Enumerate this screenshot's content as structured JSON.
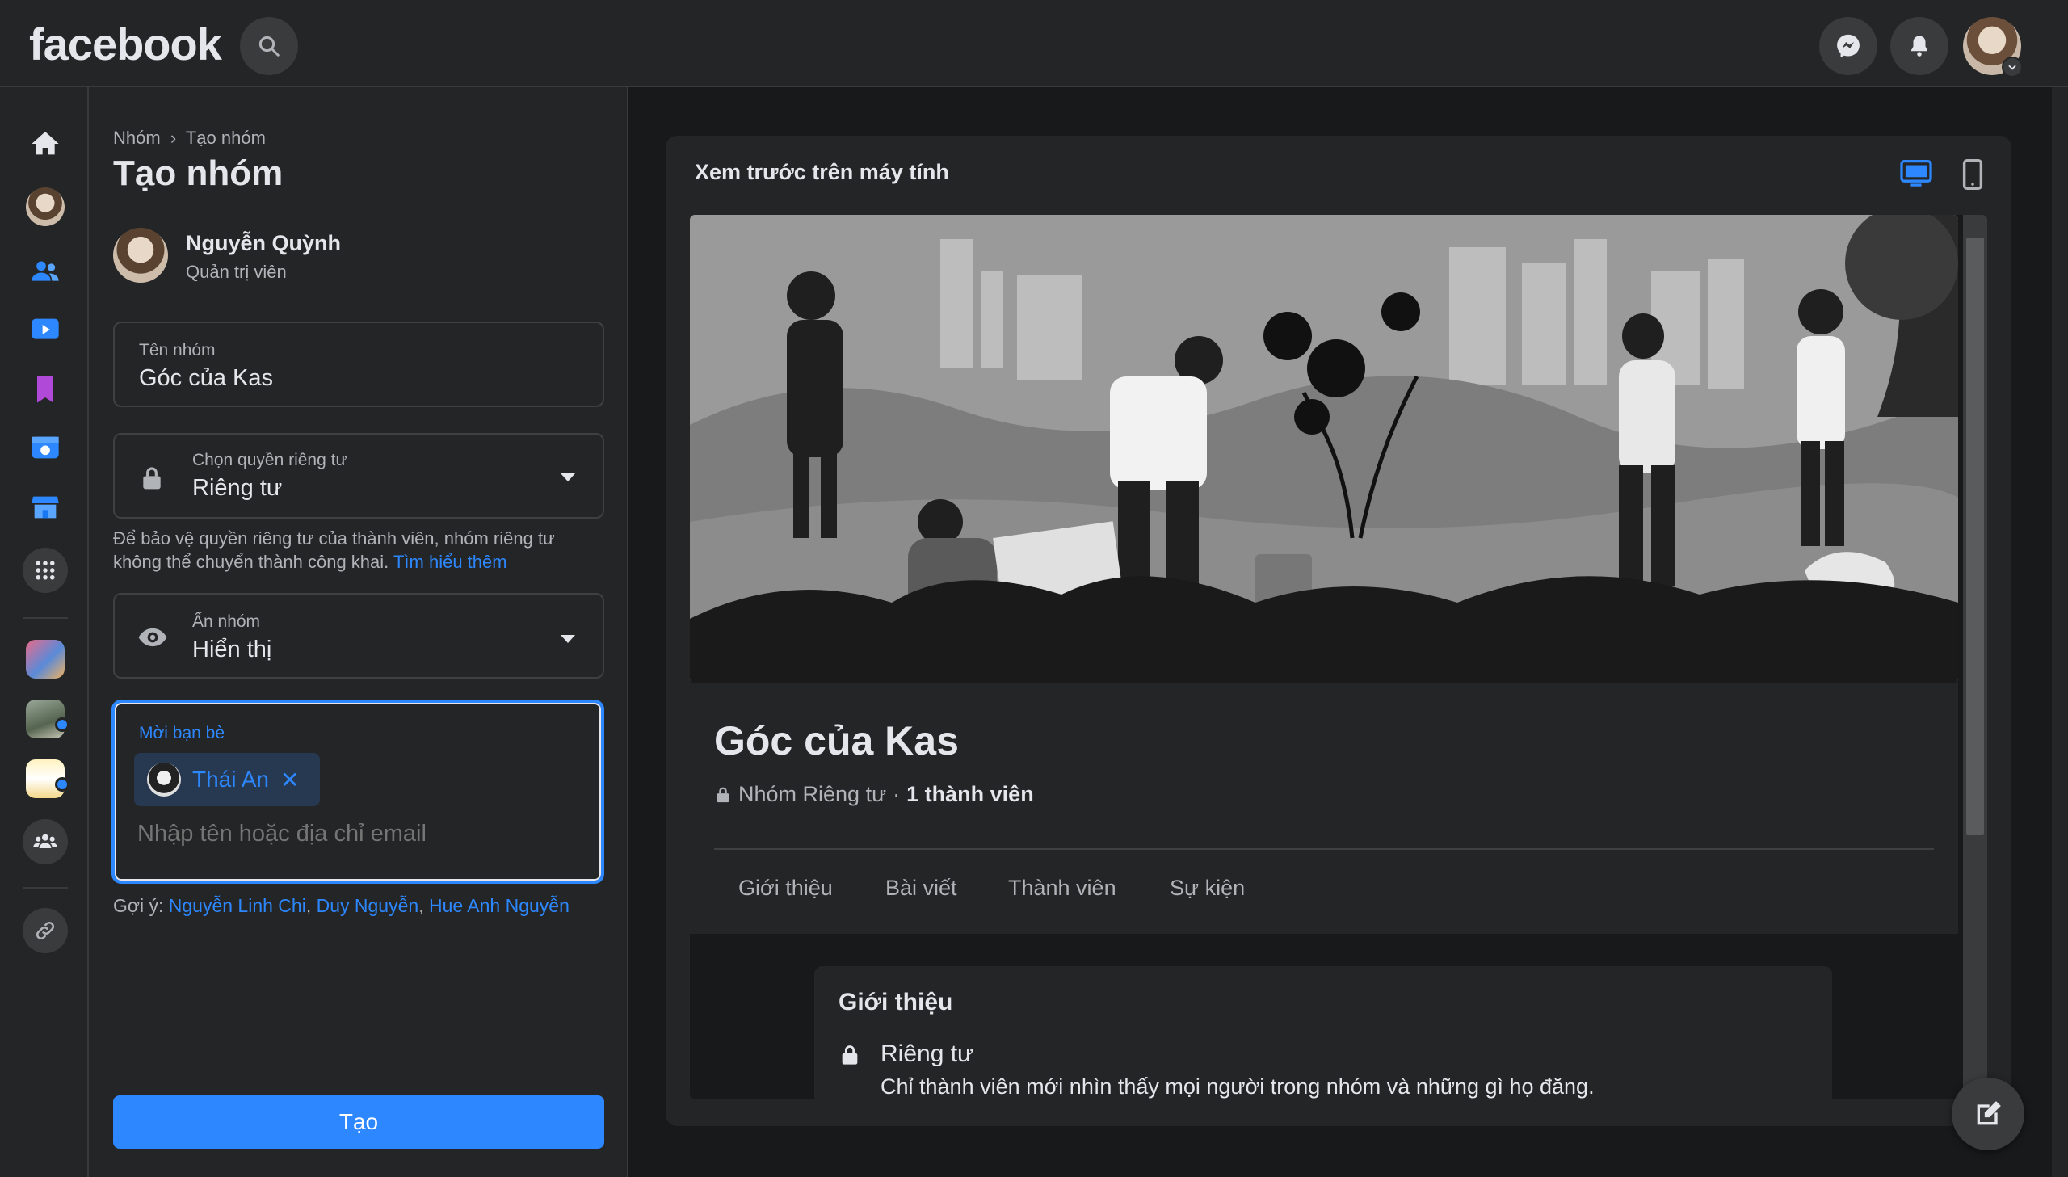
{
  "topbar": {
    "logo": "facebook",
    "search_icon": "search-icon",
    "messenger_icon": "messenger-icon",
    "notifications_icon": "bell-icon",
    "account_icon": "chevron-down-icon"
  },
  "rail": {
    "items": [
      "home-icon",
      "profile-avatar",
      "friends-icon",
      "watch-icon",
      "saved-icon",
      "memories-icon",
      "marketplace-icon",
      "menu-grid-icon",
      "group-shortcut-1",
      "group-shortcut-2",
      "group-shortcut-3",
      "groups-icon",
      "link-icon"
    ]
  },
  "create": {
    "breadcrumb_parent": "Nhóm",
    "breadcrumb_sep": "›",
    "breadcrumb_current": "Tạo nhóm",
    "title": "Tạo nhóm",
    "admin_name": "Nguyễn Quỳnh",
    "admin_role": "Quản trị viên",
    "name_label": "Tên nhóm",
    "name_value": "Góc của Kas",
    "privacy_label": "Chọn quyền riêng tư",
    "privacy_value": "Riêng tư",
    "privacy_help": "Để bảo vệ quyền riêng tư của thành viên, nhóm riêng tư không thể chuyển thành công khai.",
    "privacy_help_link": "Tìm hiểu thêm",
    "visibility_label": "Ẩn nhóm",
    "visibility_value": "Hiển thị",
    "invite_label": "Mời bạn bè",
    "invited_friend": "Thái An",
    "invite_remove": "✕",
    "invite_placeholder": "Nhập tên hoặc địa chỉ email",
    "suggest_prefix": "Gợi ý:",
    "suggestions": [
      "Nguyễn Linh Chi",
      "Duy Nguyễn",
      "Hue Anh Nguyễn"
    ],
    "create_button": "Tạo"
  },
  "preview": {
    "title": "Xem trước trên máy tính",
    "desktop_icon": "desktop-icon",
    "mobile_icon": "mobile-icon",
    "group_name": "Góc của Kas",
    "group_privacy": "Nhóm Riêng tư",
    "dot": "·",
    "member_count": "1 thành viên",
    "tabs": [
      "Giới thiệu",
      "Bài viết",
      "Thành viên",
      "Sự kiện"
    ],
    "about_title": "Giới thiệu",
    "about_privacy_title": "Riêng tư",
    "about_privacy_desc": "Chỉ thành viên mới nhìn thấy mọi người trong nhóm và những gì họ đăng."
  },
  "colors": {
    "accent": "#2d88ff",
    "background": "#18191a",
    "surface": "#242526"
  }
}
